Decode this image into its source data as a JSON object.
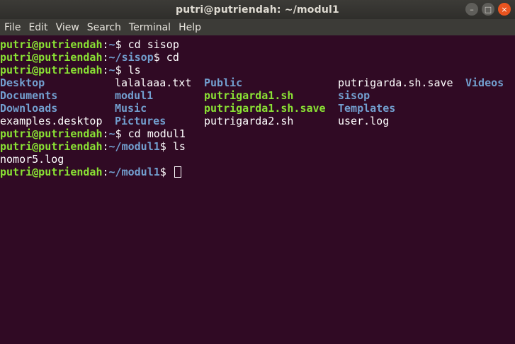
{
  "window": {
    "title": "putri@putriendah: ~/modul1",
    "buttons": {
      "minimize": "–",
      "maximize": "□",
      "close": "×"
    }
  },
  "menu": [
    "File",
    "Edit",
    "View",
    "Search",
    "Terminal",
    "Help"
  ],
  "prompt_user": "putri@putriendah",
  "lines": [
    {
      "path": "~",
      "cmd": " cd sisop"
    },
    {
      "path": "~/sisop",
      "cmd": " cd"
    },
    {
      "path": "~",
      "cmd": " ls"
    },
    {
      "path": "~",
      "cmd": " cd modul1"
    },
    {
      "path": "~/modul1",
      "cmd": " ls"
    },
    {
      "path": "~/modul1",
      "cmd": " "
    }
  ],
  "ls_home": [
    [
      "Desktop",
      "lalalaaa.txt",
      "Public",
      "putrigarda.sh.save",
      "Videos"
    ],
    [
      "Documents",
      "modul1",
      "putrigarda1.sh",
      "sisop",
      ""
    ],
    [
      "Downloads",
      "Music",
      "putrigarda1.sh.save",
      "Templates",
      ""
    ],
    [
      "examples.desktop",
      "Pictures",
      "putrigarda2.sh",
      "user.log",
      ""
    ]
  ],
  "ls_modul1": "nomor5.log",
  "colors": {
    "background": "#300a24",
    "user": "#8ae234",
    "directory": "#729fcf",
    "executable": "#8ae234",
    "close_button": "#e9541f"
  }
}
